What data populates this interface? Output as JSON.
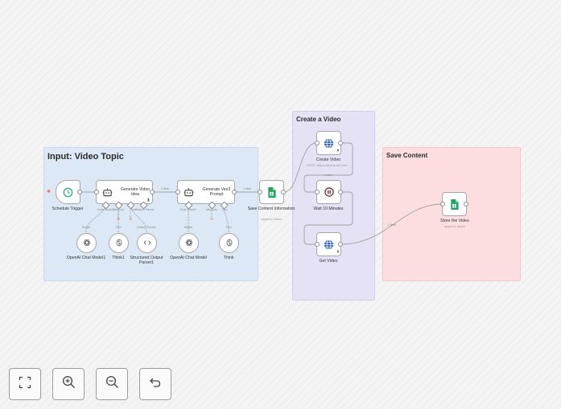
{
  "stickies": {
    "input": "Input: Video Topic",
    "video": "Create a Video",
    "save": "Save Content"
  },
  "nodes": {
    "schedule_trigger": "Schedule Trigger",
    "gen_idea": "Generate Video Idea",
    "gen_prompt": "Generate Veo3 Prompt",
    "save_info": "Save Content Information",
    "save_info_sub": "append: sheet",
    "create_video": "Create Video",
    "create_video_sub": "POST: https://queue.fal.run/f...",
    "wait": "Wait 10 Minutes",
    "get_video": "Get Video",
    "store_video": "Store the Video",
    "store_video_sub": "append: sheet"
  },
  "sub_nodes": {
    "chat_model_1": "OpenAI Chat Model1",
    "think_1": "Think1",
    "parser_1": "Structured Output Parser1",
    "chat_model_2": "OpenAI Chat Model",
    "think_2": "Think"
  },
  "ports": {
    "chat_model_req": "Chat Model*",
    "memory": "Memory",
    "tool": "Tool",
    "output_parser": "Output Parser",
    "model": "Model"
  },
  "edges": {
    "one_item": "1 item"
  },
  "controls": {
    "fit": "fit-view",
    "zoom_in": "zoom-in",
    "zoom_out": "zoom-out",
    "undo": "undo"
  },
  "colors": {
    "trigger_green": "#35b28a",
    "sheets_green": "#21a464",
    "http_blue": "#2f5fb3",
    "wait_maroon": "#6a1b2d",
    "accent_red": "#ff6d5a"
  }
}
